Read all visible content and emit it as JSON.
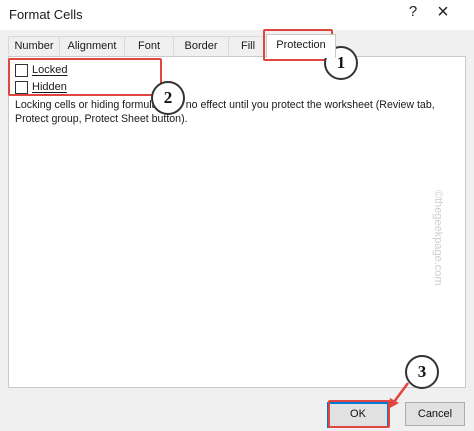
{
  "dialog": {
    "title": "Format Cells",
    "help_icon": "?",
    "close_icon": "×"
  },
  "tabs": [
    {
      "label": "Number"
    },
    {
      "label": "Alignment"
    },
    {
      "label": "Font"
    },
    {
      "label": "Border"
    },
    {
      "label": "Fill"
    },
    {
      "label": "Protection",
      "active": true
    }
  ],
  "protection": {
    "locked_label": "Locked",
    "locked_checked": false,
    "hidden_label": "Hidden",
    "hidden_checked": false,
    "description": "Locking cells or hiding formulas has no effect until you protect the worksheet (Review tab, Protect group, Protect Sheet button)."
  },
  "buttons": {
    "ok_label": "OK",
    "cancel_label": "Cancel"
  },
  "annotations": {
    "step1": "1",
    "step2": "2",
    "step3": "3",
    "highlight_color": "#e0453f"
  },
  "watermark": "©thegeekpage.com"
}
